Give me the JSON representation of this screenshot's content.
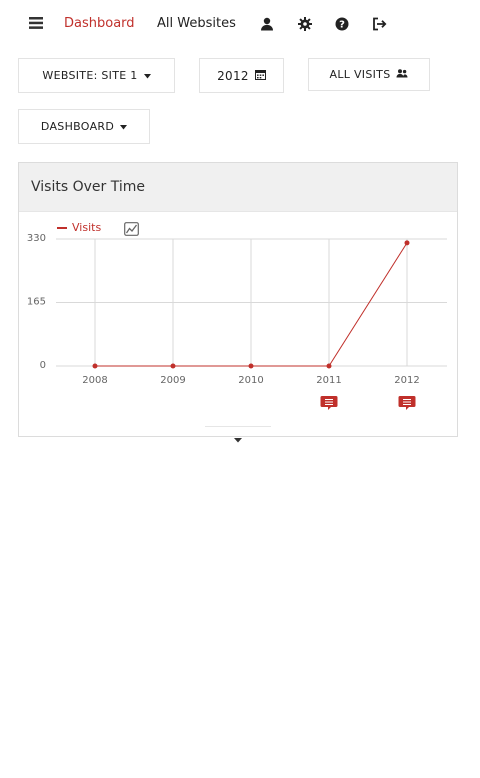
{
  "nav": {
    "menu_icon": "menu-icon",
    "dashboard_label": "Dashboard",
    "all_websites_label": "All Websites",
    "icons": [
      "user-icon",
      "gear-icon",
      "help-icon",
      "logout-icon"
    ],
    "active_color": "#c0302b"
  },
  "selectors": {
    "website": "WEBSITE: SITE 1",
    "year": "2012",
    "segment": "ALL VISITS",
    "view": "DASHBOARD"
  },
  "widget": {
    "title": "Visits Over Time"
  },
  "chart_data": {
    "type": "line",
    "categories": [
      "2008",
      "2009",
      "2010",
      "2011",
      "2012"
    ],
    "series": [
      {
        "name": "Visits",
        "values": [
          0,
          0,
          0,
          0,
          320
        ],
        "color": "#c0302b"
      }
    ],
    "yticks": [
      "0",
      "165",
      "330"
    ],
    "ylim": [
      0,
      330
    ],
    "grid": true,
    "annotations_at": [
      "2011",
      "2012"
    ],
    "legend_position": "top-left"
  }
}
